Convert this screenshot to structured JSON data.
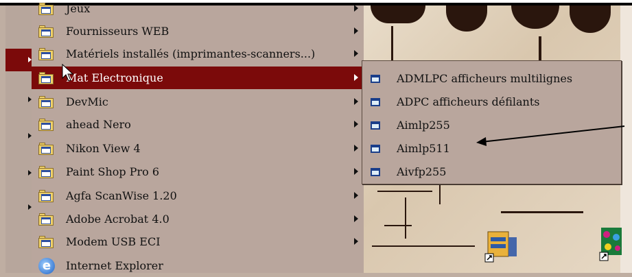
{
  "menu": {
    "items": [
      {
        "label": "Jeux",
        "has_submenu": true
      },
      {
        "label": "Fournisseurs WEB",
        "has_submenu": true
      },
      {
        "label": "Matériels installés (imprimantes-scanners...)",
        "has_submenu": true
      },
      {
        "label": "Mat Electronique",
        "has_submenu": true,
        "selected": true
      },
      {
        "label": "DevMic",
        "has_submenu": true
      },
      {
        "label": "ahead Nero",
        "has_submenu": true
      },
      {
        "label": "Nikon View 4",
        "has_submenu": true
      },
      {
        "label": "Paint Shop Pro 6",
        "has_submenu": true
      },
      {
        "label": "Agfa ScanWise 1.20",
        "has_submenu": true
      },
      {
        "label": "Adobe Acrobat 4.0",
        "has_submenu": true
      },
      {
        "label": "Modem USB ECI",
        "has_submenu": true
      },
      {
        "label": "Internet Explorer",
        "has_submenu": false,
        "icon": "internet-explorer-icon"
      }
    ]
  },
  "submenu": {
    "items": [
      {
        "label": "ADMLPC afficheurs multilignes"
      },
      {
        "label": "ADPC afficheurs défilants"
      },
      {
        "label": "Aimlp255"
      },
      {
        "label": "Aimlp511"
      },
      {
        "label": "Aivfp255"
      }
    ]
  },
  "colors": {
    "selected": "#7b0a0a",
    "menu_bg": "#b9a69d",
    "arrow_annotation": "#000000"
  },
  "icons": {
    "folder": "program-folder-icon",
    "shortcut": "shortcut-icon"
  }
}
